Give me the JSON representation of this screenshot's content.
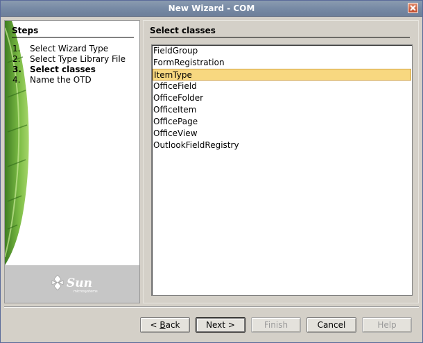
{
  "window": {
    "title": "New Wizard - COM"
  },
  "steps": {
    "heading": "Steps",
    "items": [
      {
        "num": "1.",
        "label": "Select Wizard Type"
      },
      {
        "num": "2.",
        "label": "Select Type Library File"
      },
      {
        "num": "3.",
        "label": "Select classes"
      },
      {
        "num": "4.",
        "label": "Name the OTD"
      }
    ],
    "current_index": 2
  },
  "branding": {
    "logo_text": "Sun",
    "logo_subtext": "microsystems"
  },
  "content": {
    "heading": "Select classes",
    "classes": [
      "FieldGroup",
      "FormRegistration",
      "ItemType",
      "OfficeField",
      "OfficeFolder",
      "OfficeItem",
      "OfficePage",
      "OfficeView",
      "OutlookFieldRegistry"
    ],
    "selected": "ItemType"
  },
  "buttons": {
    "back_prefix": "< ",
    "back_mnemonic": "B",
    "back_rest": "ack",
    "next": "Next >",
    "finish": "Finish",
    "cancel": "Cancel",
    "help": "Help"
  },
  "colors": {
    "selection": "#f8d880",
    "titlebar": "#7689a4",
    "leaf_green": "#6aa83a"
  }
}
